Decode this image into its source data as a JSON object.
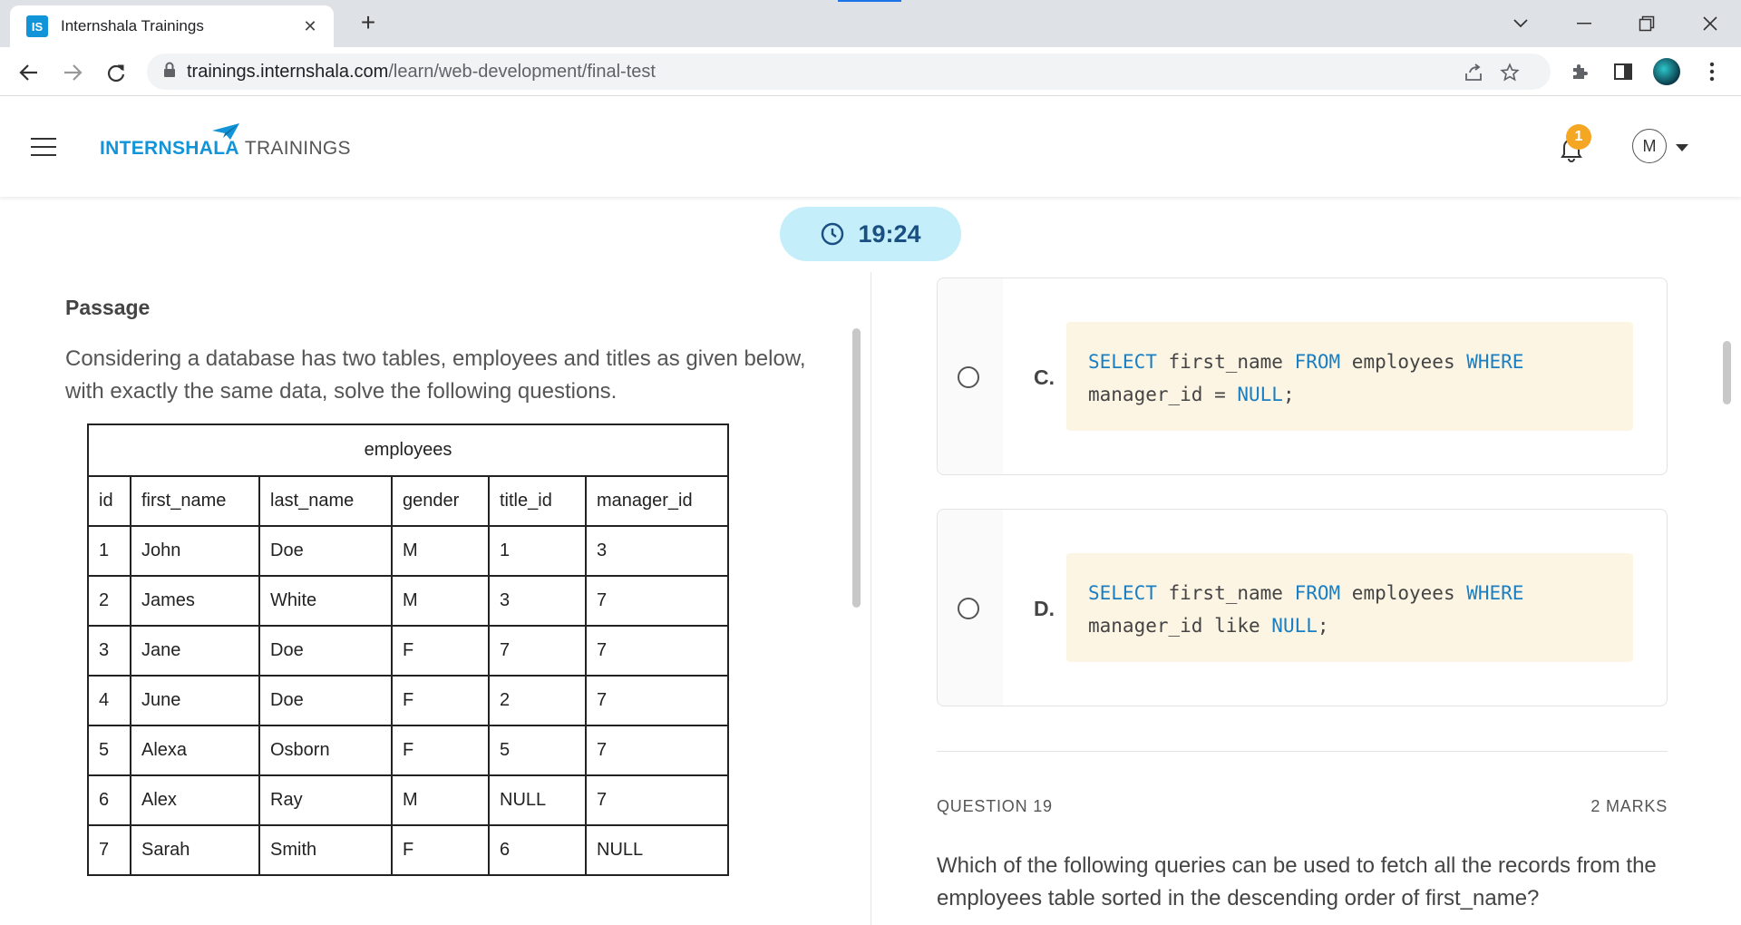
{
  "browser": {
    "tab_title": "Internshala Trainings",
    "favicon_text": "IS",
    "url_host": "trainings.internshala.com",
    "url_path": "/learn/web-development/final-test"
  },
  "header": {
    "logo_intern": "INTERN",
    "logo_shala": "SHALA",
    "logo_trainings": "TRAININGS",
    "notification_count": "1",
    "avatar_initial": "M"
  },
  "timer": "19:24",
  "passage": {
    "title": "Passage",
    "text": "Considering a database has two tables, employees and titles as given below, with exactly the same data, solve the following questions.",
    "table": {
      "caption": "employees",
      "headers": [
        "id",
        "first_name",
        "last_name",
        "gender",
        "title_id",
        "manager_id"
      ],
      "rows": [
        [
          "1",
          "John",
          "Doe",
          "M",
          "1",
          "3"
        ],
        [
          "2",
          "James",
          "White",
          "M",
          "3",
          "7"
        ],
        [
          "3",
          "Jane",
          "Doe",
          "F",
          "7",
          "7"
        ],
        [
          "4",
          "June",
          "Doe",
          "F",
          "2",
          "7"
        ],
        [
          "5",
          "Alexa",
          "Osborn",
          "F",
          "5",
          "7"
        ],
        [
          "6",
          "Alex",
          "Ray",
          "M",
          "NULL",
          "7"
        ],
        [
          "7",
          "Sarah",
          "Smith",
          "F",
          "6",
          "NULL"
        ]
      ]
    }
  },
  "options": [
    {
      "letter": "C.",
      "code": {
        "kw1": "SELECT",
        "t1": " first_name ",
        "kw2": "FROM",
        "t2": " employees ",
        "kw3": "WHERE",
        "t3": "manager_id = ",
        "kw4": "NULL",
        "t4": ";"
      }
    },
    {
      "letter": "D.",
      "code": {
        "kw1": "SELECT",
        "t1": " first_name ",
        "kw2": "FROM",
        "t2": " employees ",
        "kw3": "WHERE",
        "t3": "manager_id like ",
        "kw4": "NULL",
        "t4": ";"
      }
    }
  ],
  "question": {
    "label": "QUESTION 19",
    "marks": "2 MARKS",
    "text": "Which of the following queries can be used to fetch all the records from the employees table sorted in the descending order of first_name?"
  },
  "colors": {
    "brand_blue": "#1295d8",
    "timer_bg": "#c4eef9",
    "code_bg": "#fdf5e4",
    "keyword": "#1a7ec2",
    "badge": "#f5a623"
  },
  "icons": [
    "back-arrow-icon",
    "forward-arrow-icon",
    "reload-icon",
    "lock-icon",
    "share-icon",
    "star-icon",
    "extensions-icon",
    "sidepanel-icon",
    "menu-dots-icon",
    "clock-icon",
    "bell-icon",
    "hamburger-icon"
  ]
}
